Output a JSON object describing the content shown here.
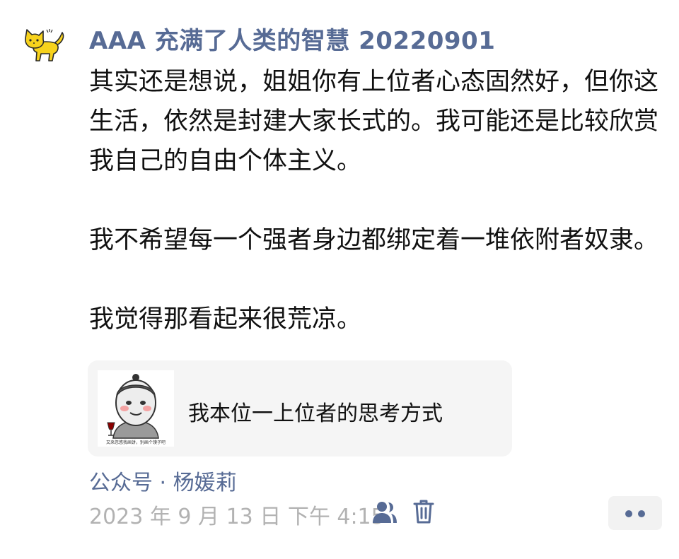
{
  "post": {
    "author_name": "AAA 充满了人类的智慧 20220901",
    "avatar_icon": "yellow-cat-icon",
    "paragraphs": [
      "其实还是想说，姐姐你有上位者心态固然好，但你这生活，依然是封建大家长式的。我可能还是比较欣赏我自己的自由个体主义。",
      "我不希望每一个强者身边都绑定着一堆依附者奴隶。",
      "我觉得那看起来很荒凉。"
    ],
    "shared_article": {
      "title": "我本位一上位者的思考方式",
      "thumbnail_caption": "又来忽悠我画饼，别画个馍子吧"
    },
    "source_label": "公众号 · 杨媛莉",
    "timestamp": "2023 年 9 月 13 日 下午 4:15",
    "actions": {
      "visibility_icon": "people-icon",
      "delete_icon": "trash-icon",
      "more_icon": "more-dots-icon"
    }
  },
  "colors": {
    "link_blue": "#576b95",
    "text_primary": "#111111",
    "text_secondary": "#b2b2b2",
    "card_background": "#f5f5f5",
    "avatar_yellow": "#f7d21c"
  }
}
